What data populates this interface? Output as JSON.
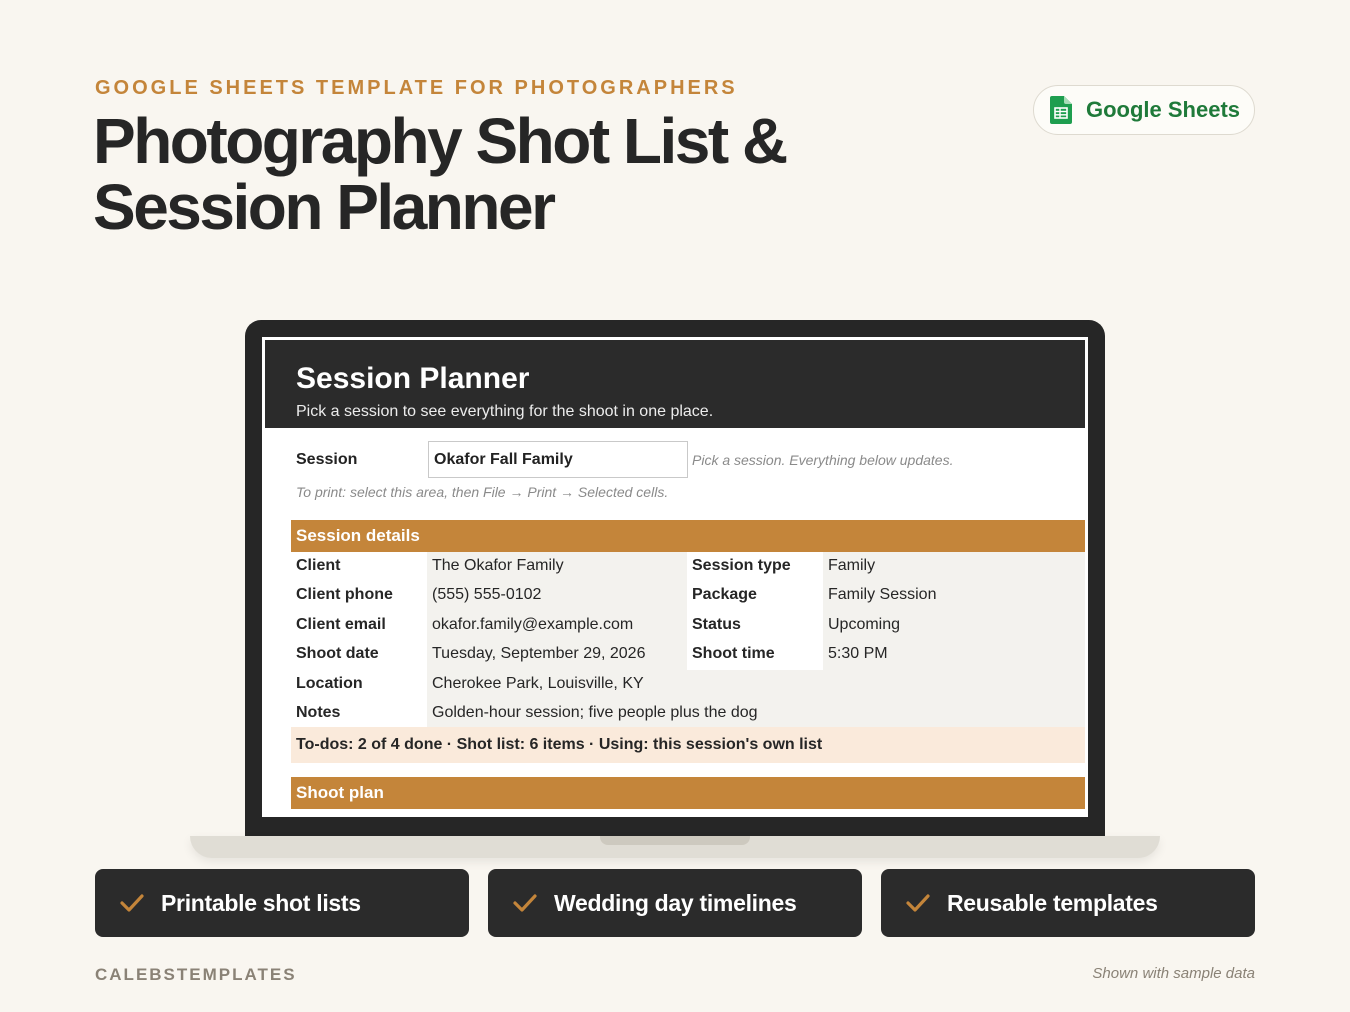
{
  "eyebrow": "GOOGLE SHEETS TEMPLATE FOR PHOTOGRAPHERS",
  "headline": {
    "line1": "Photography Shot List &",
    "line2": "Session Planner"
  },
  "badge": {
    "label": "Google Sheets",
    "icon": "google-sheets-icon",
    "color": "#1f7a3a"
  },
  "sheet": {
    "title": "Session Planner",
    "subtitle": "Pick a session to see everything for the shoot in one place.",
    "session_label": "Session",
    "session_value": "Okafor Fall Family",
    "session_hint": "Pick a session. Everything below updates.",
    "print_hint": "To print: select this area, then File → Print → Selected cells.",
    "details_heading": "Session details",
    "details": {
      "client_label": "Client",
      "client_value": "The Okafor Family",
      "session_type_label": "Session type",
      "session_type_value": "Family",
      "phone_label": "Client phone",
      "phone_value": "(555) 555-0102",
      "package_label": "Package",
      "package_value": "Family Session",
      "email_label": "Client email",
      "email_value": "okafor.family@example.com",
      "status_label": "Status",
      "status_value": "Upcoming",
      "date_label": "Shoot date",
      "date_value": "Tuesday, September 29, 2026",
      "time_label": "Shoot time",
      "time_value": "5:30 PM",
      "location_label": "Location",
      "location_value": "Cherokee Park, Louisville, KY",
      "notes_label": "Notes",
      "notes_value": "Golden-hour session; five people plus the dog"
    },
    "summary": "To-dos: 2 of 4 done · Shot list: 6 items · Using: this session's own list",
    "plan_heading": "Shoot plan"
  },
  "features": [
    {
      "label": "Printable shot lists",
      "icon": "check-icon"
    },
    {
      "label": "Wedding day timelines",
      "icon": "check-icon"
    },
    {
      "label": "Reusable templates",
      "icon": "check-icon"
    }
  ],
  "footer": {
    "brand": "CALEBSTEMPLATES",
    "note": "Shown with sample data"
  },
  "colors": {
    "background": "#f9f6f0",
    "accent": "#c4853a",
    "dark": "#2b2b2b",
    "summary_bg": "#faeadb"
  }
}
